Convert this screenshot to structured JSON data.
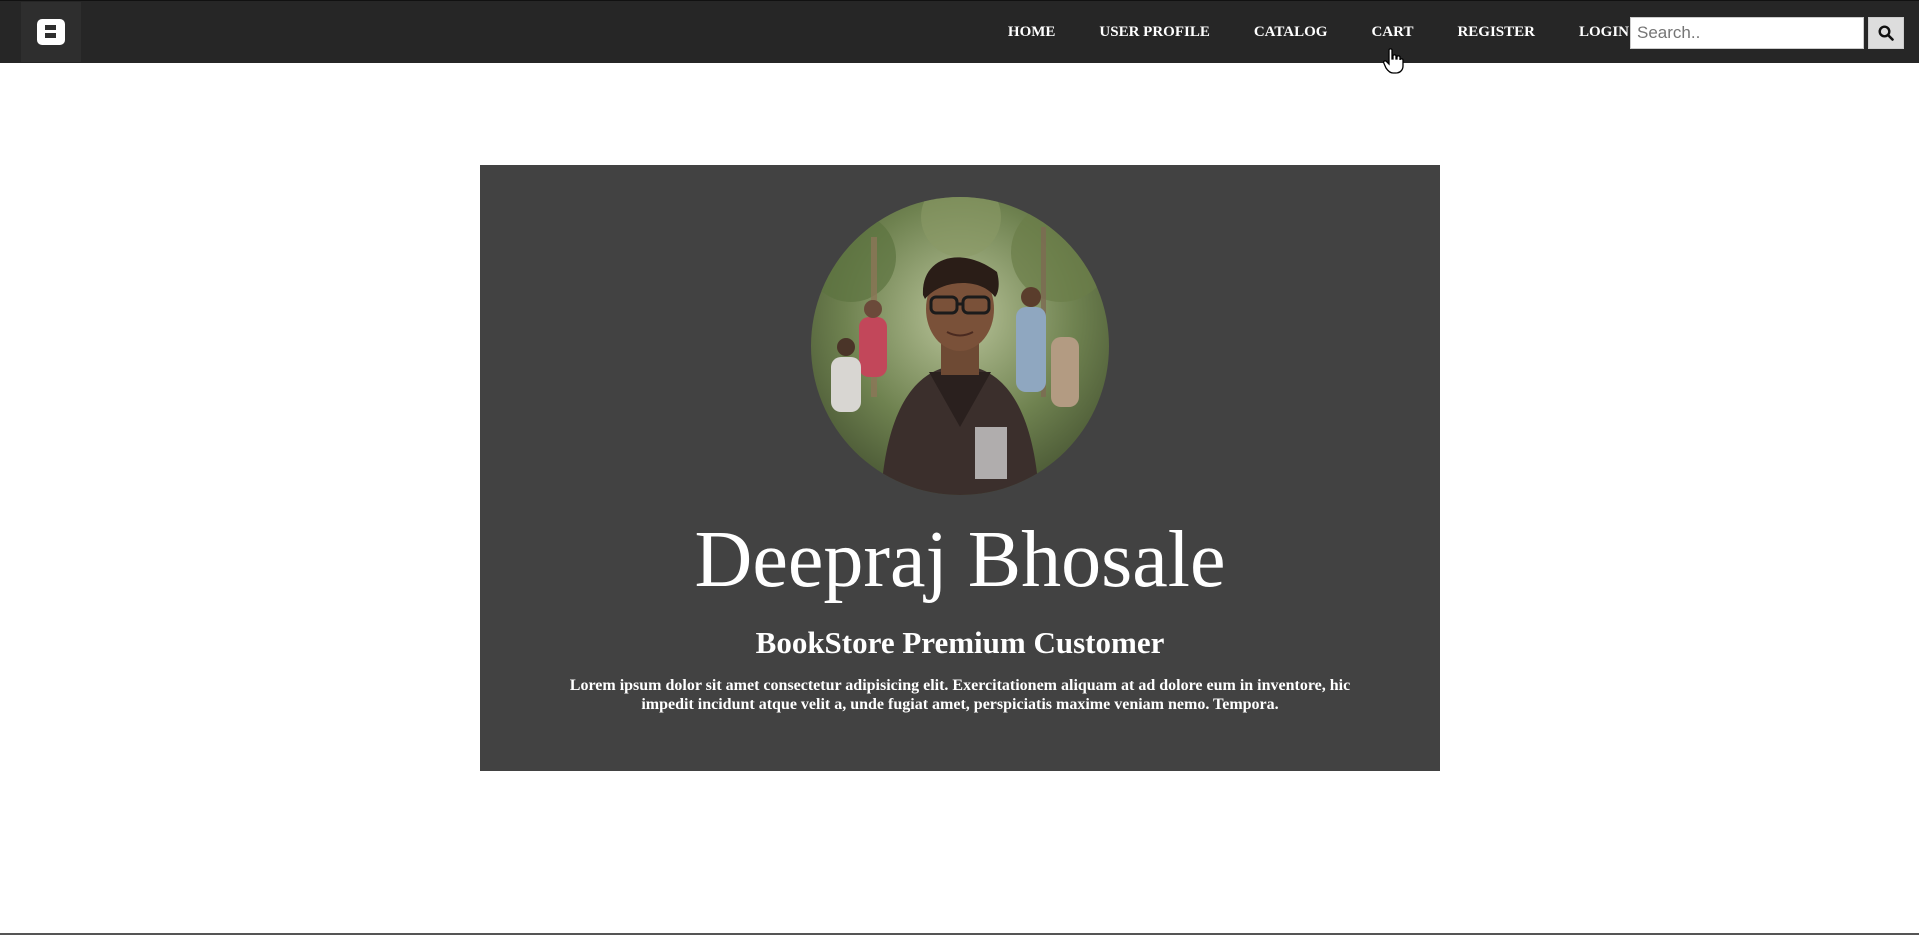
{
  "nav": {
    "logo_icon": "bookstore-b-logo",
    "links": [
      "HOME",
      "USER PROFILE",
      "CATALOG",
      "CART",
      "REGISTER",
      "LOGIN"
    ],
    "search_placeholder": "Search..",
    "search_icon": "search-icon"
  },
  "profile": {
    "name": "Deepraj Bhosale",
    "tier": "BookStore Premium Customer",
    "bio": "Lorem ipsum dolor sit amet consectetur adipisicing elit. Exercitationem aliquam at ad dolore eum in inventore, hic impedit incidunt atque velit a, unde fugiat amet, perspiciatis maxime veniam nemo. Tempora."
  },
  "colors": {
    "navbar": "#262626",
    "card": "#424242",
    "text": "#ffffff"
  }
}
